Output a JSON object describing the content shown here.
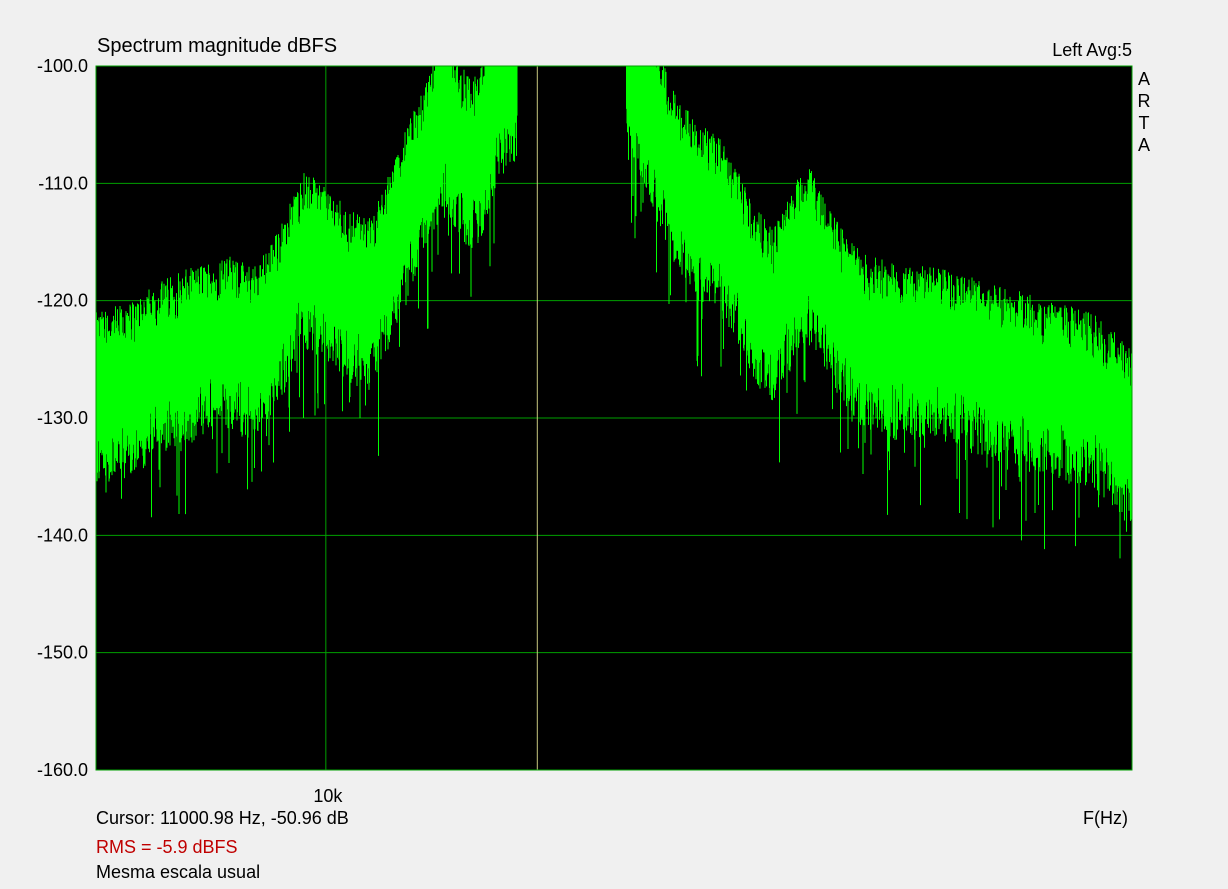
{
  "chart_data": {
    "type": "line",
    "title": "Spectrum magnitude dBFS",
    "channel_label": "Left  Avg:5",
    "watermark": [
      "A",
      "R",
      "T",
      "A"
    ],
    "xlabel": "F(Hz)",
    "ylabel": "",
    "x_scale": "log",
    "xlim": [
      6000,
      60000
    ],
    "ylim": [
      -160,
      -100
    ],
    "y_ticks": [
      -100,
      -110,
      -120,
      -130,
      -140,
      -150,
      -160
    ],
    "y_tick_labels": [
      "-100.0",
      "-110.0",
      "-120.0",
      "-130.0",
      "-140.0",
      "-150.0",
      "-160.0"
    ],
    "x_ticks": [
      10000
    ],
    "x_tick_labels": [
      "10k"
    ],
    "x_gridlines": [
      10000,
      16000
    ],
    "grid": true,
    "background_color": "#000000",
    "grid_color": "#00a000",
    "center_line_color": "#c8c880",
    "series": [
      {
        "color": "#00ff00",
        "x": [
          6000,
          6500,
          7000,
          7500,
          8000,
          8500,
          9000,
          9500,
          10000,
          10500,
          11000,
          11500,
          12000,
          12500,
          13000,
          13500,
          14000,
          14500,
          15000,
          15300,
          19500,
          20000,
          20500,
          21000,
          21500,
          22000,
          23000,
          24000,
          25000,
          26000,
          27000,
          28000,
          29000,
          30000,
          31000,
          33000,
          36000,
          39000,
          42000,
          46000,
          50000,
          55000,
          60000
        ],
        "values": [
          -128,
          -127,
          -125,
          -124,
          -123,
          -124,
          -121,
          -116,
          -117,
          -119,
          -120,
          -116,
          -112,
          -108,
          -104,
          -107,
          -108,
          -103,
          -101,
          -100,
          -100,
          -101,
          -103,
          -106,
          -108,
          -110,
          -112,
          -113,
          -116,
          -119,
          -121,
          -118,
          -115,
          -117,
          -120,
          -123,
          -124,
          -124,
          -125,
          -126,
          -127,
          -128,
          -131
        ]
      }
    ]
  },
  "status": {
    "cursor_text": "Cursor: 11000.98 Hz, -50.96 dB",
    "rms_text": "RMS =   -5.9 dBFS",
    "note_text": "Mesma escala usual"
  }
}
